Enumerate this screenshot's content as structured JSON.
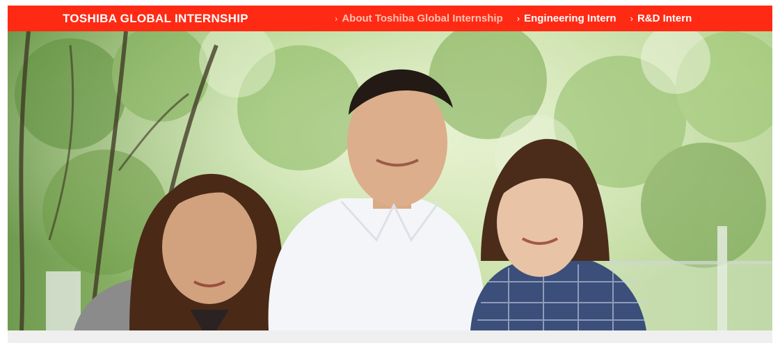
{
  "header": {
    "brand": "TOSHIBA GLOBAL INTERNSHIP",
    "nav": [
      {
        "label": "About Toshiba Global Internship",
        "current": true
      },
      {
        "label": "Engineering Intern",
        "current": false
      },
      {
        "label": "R&D Intern",
        "current": false
      }
    ]
  },
  "colors": {
    "accent": "#ff2a14",
    "current_link": "#ffc2b2",
    "footer_strip": "#efefef"
  },
  "icons": {
    "nav_chevron": "chevron-right-icon"
  }
}
